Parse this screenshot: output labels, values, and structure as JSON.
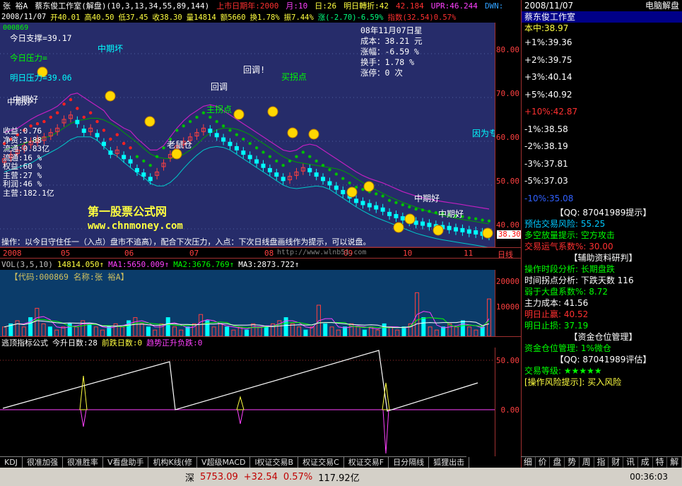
{
  "titlebar": {
    "symbol": "张  裕A",
    "formula": "蔡东俊工作室(解盘)(10,3,13,34,55,89,144)",
    "list_date": "上市日期年:2000",
    "month": "月:10",
    "day": "日:26",
    "tomorrow_turn": "明日轉折:42",
    "v1": "42.184",
    "upr": "UPR:46.244",
    "dwn": "DWN:"
  },
  "infobar": {
    "date": "2008/11/07",
    "open": "开40.01",
    "high": "高40.50",
    "low": "低37.45",
    "close": "收38.30",
    "volume": "量14814",
    "amount": "额5660",
    "turnover": "换1.78%",
    "amplitude": "振7.44%",
    "change": "涨(-2.70)-6.59%",
    "index": "指数(32.54)0.57%"
  },
  "main_chart": {
    "top_code": "000869",
    "left_labels": [
      {
        "text": "今日支撑=39.17",
        "color": "#ffffff"
      },
      {
        "text": "今日压力=",
        "color": "#00ff00"
      },
      {
        "text": "明日压力=39.06",
        "color": "#00ffff"
      }
    ],
    "corner_label": "中期好",
    "fundamentals": [
      "收益:0.76",
      "净资:3.88",
      "流通:0.83亿",
      "流通:16 %",
      "权益:60 %",
      "主营:27 %",
      "利润:46 %",
      "主营:182.1亿"
    ],
    "info_box": [
      "08年11月07日星",
      "成本：38.21 元",
      "涨幅：-6.59 %",
      "换手：1.78 %",
      "涨停：0 次"
    ],
    "watermark_title": "第一股票公式网",
    "watermark_url": "www.chnmoney.com",
    "bottom_line": "操作：以今日守住任一（入点）盘市不追高），配合下次压力，入点：下次日线盘画线作为提示，可以说盘。",
    "annotations": [
      {
        "text": "中期坏",
        "color": "#00ffff"
      },
      {
        "text": "中期好",
        "color": "#ffffff"
      },
      {
        "text": "老鼠仓",
        "color": "#ffffff"
      },
      {
        "text": "回调!",
        "color": "#ffffff"
      },
      {
        "text": "买拐点",
        "color": "#00ff00"
      },
      {
        "text": "主拐点",
        "color": "#00ff00"
      },
      {
        "text": "回调",
        "color": "#ffffff"
      },
      {
        "text": "因为专",
        "color": "#00ffff"
      },
      {
        "text": "中期好",
        "color": "#ffffff"
      },
      {
        "text": "中期好",
        "color": "#ffffff"
      }
    ],
    "price_badge": "38.30",
    "yticks": [
      "80.00",
      "70.00",
      "60.00",
      "50.00",
      "40.00"
    ],
    "candles": [
      56,
      57,
      58,
      59,
      60,
      60.5,
      61,
      62,
      63,
      65,
      66,
      64,
      62,
      63,
      61,
      59,
      57,
      58,
      56,
      55,
      53,
      52,
      51,
      53,
      55,
      57,
      59,
      60,
      61,
      62,
      63,
      62,
      61,
      60,
      59,
      58,
      57,
      56,
      55,
      54,
      53,
      52,
      51,
      52,
      53,
      54,
      53,
      52,
      51,
      50,
      49,
      48,
      47,
      46,
      45.5,
      45,
      44.5,
      44,
      43,
      42.5,
      42,
      41.5,
      41,
      40.8,
      40.5,
      40.2,
      40.0,
      39.8,
      39.5,
      39.3,
      39.0,
      38.8,
      38.5,
      38.3
    ]
  },
  "date_axis": {
    "labels": [
      "2008",
      "05",
      "06",
      "07",
      "08",
      "09",
      "10",
      "11"
    ],
    "right": "日线",
    "url": "http://www.wlnb51.com"
  },
  "vol_bar": {
    "label": "VOL(3,5,10)",
    "value": "14814.050↑",
    "ma1": "MA1:5650.009↑",
    "ma2": "MA2:3676.769↑",
    "ma3": "MA3:2873.722↑"
  },
  "vol_chart": {
    "code_line": "【代码:000869 名称:张  裕A】",
    "yticks": [
      "20000",
      "10000"
    ],
    "bars": [
      3,
      4,
      5,
      3,
      6,
      9,
      4,
      3,
      2,
      3,
      4,
      3,
      5,
      4,
      3,
      2,
      3,
      4,
      3,
      5,
      6,
      4,
      3,
      2,
      4,
      6,
      3,
      2,
      3,
      4,
      7,
      5,
      3,
      4,
      3,
      2,
      3,
      2,
      4,
      3,
      3,
      4,
      5,
      6,
      4,
      3,
      2,
      3,
      10,
      4,
      3,
      2,
      3,
      4,
      3,
      2,
      3,
      2,
      4,
      3,
      2,
      3,
      4,
      14,
      6,
      3,
      2,
      3,
      4,
      3,
      5,
      3,
      2,
      3,
      12
    ]
  },
  "indicator": {
    "name": "逃顶指标公式",
    "up_days": "今升日数:28",
    "down_days": "前跌日数:0",
    "trend": "趋势正升负跌:0",
    "yticks": [
      "50.00",
      "0.00"
    ]
  },
  "tabs": [
    "KDJ",
    "很准加强",
    "很准胜率",
    "V看盘助手",
    "机构K线(修",
    "V超级MACD",
    "l权证交易B",
    "权证交易C",
    "权证交易F",
    "日分隔线",
    "狐狸出击"
  ],
  "right_panel": {
    "date": "2008/11/07",
    "title": "电脑解盘",
    "studio": "蔡东俊工作室",
    "cost": "本中:38.97",
    "levels": [
      {
        "text": "+1%:39.36",
        "color": "#ffffff"
      },
      {
        "text": "+2%:39.75",
        "color": "#ffffff"
      },
      {
        "text": "+3%:40.14",
        "color": "#ffffff"
      },
      {
        "text": "+5%:40.92",
        "color": "#ffffff"
      },
      {
        "text": "+10%:42.87",
        "color": "#ff3030"
      },
      {
        "text": "-1%:38.58",
        "color": "#ffffff"
      },
      {
        "text": "-2%:38.19",
        "color": "#ffffff"
      },
      {
        "text": "-3%:37.81",
        "color": "#ffffff"
      },
      {
        "text": "-5%:37.03",
        "color": "#ffffff"
      },
      {
        "text": "-10%:35.08",
        "color": "#3060ff"
      }
    ],
    "qq_line": "【QQ: 87041989提示】",
    "risk": "预估交易风险: 55.25",
    "bull_bear": "多空放量提示: 空方攻击",
    "luck": "交易运气系数%: 30.00",
    "research": "【辅助资料研判】",
    "timing": "操作时段分析: 长期盘跌",
    "turn_analysis": "时间拐点分析: 下跌天数  116",
    "vs_market": "弱于大盘系数%: 8.72",
    "main_cost": "主力成本: 41.56",
    "take_profit": "明日止赢: 40.52",
    "stop_loss": "明日止损: 37.19",
    "fund_mgmt": "【资金仓位管理】",
    "position": "资金仓位管理: 1%微仓",
    "qq_eval": "【QQ: 87041989评估】",
    "grade_label": "交易等级:",
    "grade_stars": "★★★★★",
    "risk_tip": "[操作风险提示]: 买入风险",
    "buttons": [
      "细",
      "价",
      "盘",
      "势",
      "周",
      "指",
      "财",
      "讯",
      "成",
      "特",
      "解"
    ]
  },
  "statusbar": {
    "market": "深",
    "index": "5753.09",
    "change": "+32.54",
    "pct": "0.57%",
    "amount": "117.92亿",
    "time": "00:36:03"
  }
}
